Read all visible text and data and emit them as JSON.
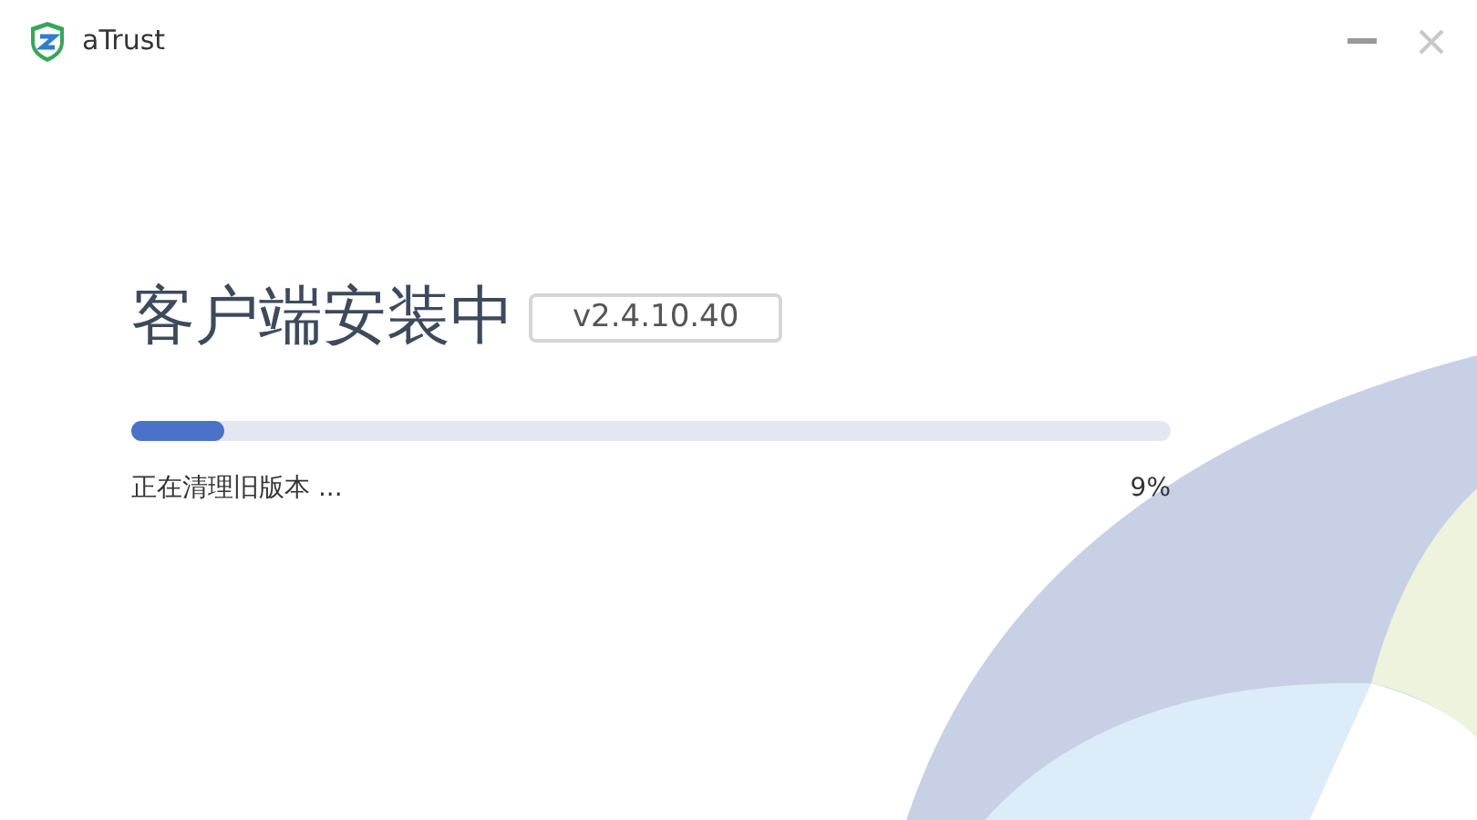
{
  "window": {
    "title": "aTrust"
  },
  "heading": "客户端安装中",
  "version": "v2.4.10.40",
  "progress": {
    "level": 0.09,
    "status": "正在清理旧版本 ...",
    "percent": "9%"
  }
}
